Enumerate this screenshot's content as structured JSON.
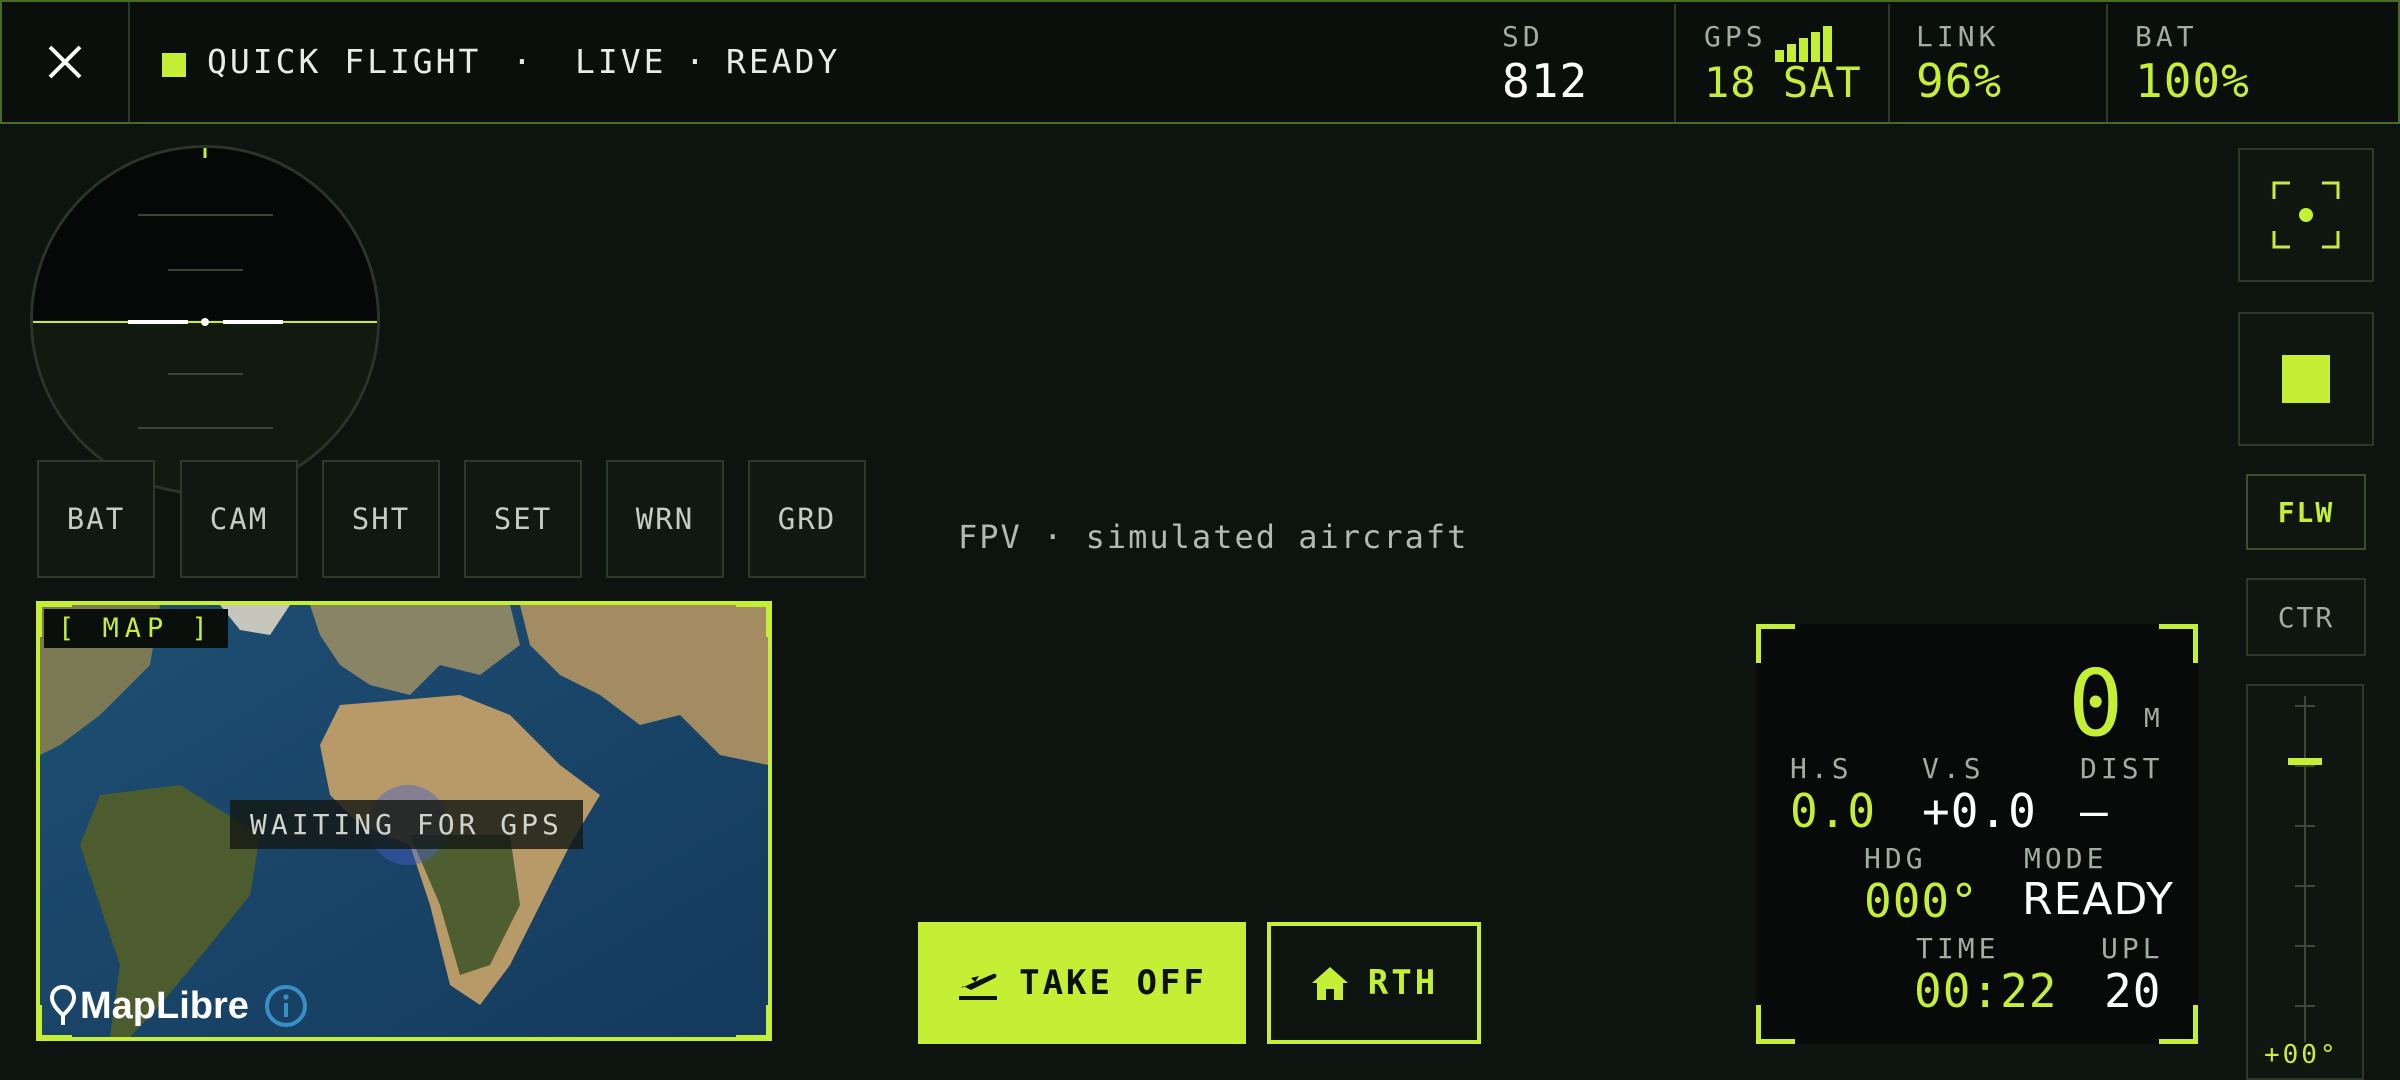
{
  "topbar": {
    "mode": "QUICK FLIGHT",
    "sep1": "·",
    "live": "LIVE",
    "sep2": "·",
    "state": "READY",
    "sd_label": "SD",
    "sd_value": "812",
    "gps_label": "GPS",
    "gps_value": "18 SAT",
    "link_label": "LINK",
    "link_value": "96%",
    "bat_label": "BAT",
    "bat_value": "100%"
  },
  "quick_buttons": [
    "BAT",
    "CAM",
    "SHT",
    "SET",
    "WRN",
    "GRD"
  ],
  "map": {
    "tag": "[ MAP ]",
    "status": "WAITING FOR GPS",
    "attribution": "MapLibre"
  },
  "center_note": "FPV · simulated aircraft",
  "actions": {
    "takeoff": "TAKE OFF",
    "rth": "RTH"
  },
  "telemetry": {
    "altitude": "0",
    "altitude_unit": "M",
    "hs_label": "H.S",
    "hs_value": "0.0",
    "vs_label": "V.S",
    "vs_value": "+0.0",
    "dist_label": "DIST",
    "dist_value": "—",
    "hdg_label": "HDG",
    "hdg_value": "000°",
    "mode_label": "MODE",
    "mode_value": "READY",
    "time_label": "TIME",
    "time_value": "00:22",
    "upl_label": "UPL",
    "upl_value": "20"
  },
  "rail": {
    "flw": "FLW",
    "ctr": "CTR",
    "gimbal_readout": "+00°"
  },
  "colors": {
    "accent": "#c5ef35",
    "background": "#0d130f"
  },
  "icons": {
    "close": "close-icon",
    "takeoff": "takeoff-icon",
    "home": "home-icon",
    "focus": "focus-frame-icon",
    "stop": "stop-icon",
    "gps_signal": "signal-bars-icon",
    "info": "info-icon",
    "pin": "map-pin-icon"
  }
}
